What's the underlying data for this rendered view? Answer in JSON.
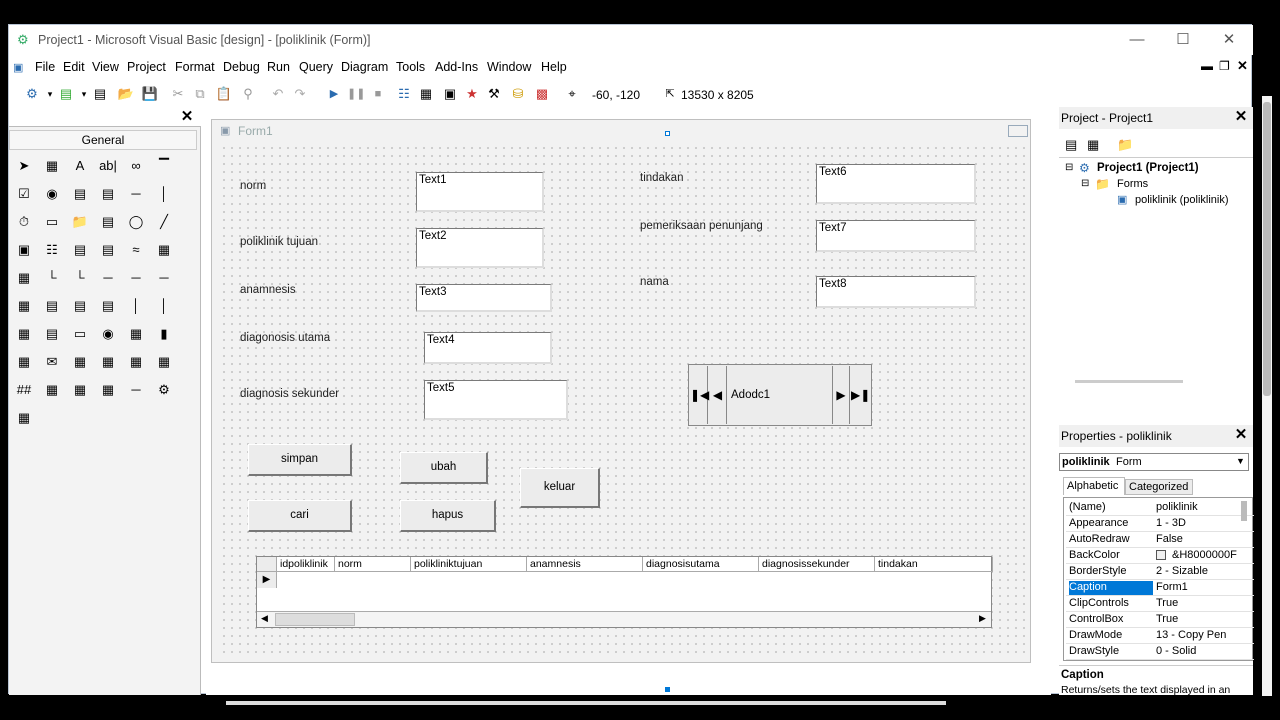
{
  "window": {
    "title": "Project1 - Microsoft Visual Basic [design] - [poliklinik (Form)]"
  },
  "menu": [
    "File",
    "Edit",
    "View",
    "Project",
    "Format",
    "Debug",
    "Run",
    "Query",
    "Diagram",
    "Tools",
    "Add-Ins",
    "Window",
    "Help"
  ],
  "toolbar": {
    "position": "-60, -120",
    "size": "13530 x 8205"
  },
  "toolbox": {
    "title": "General"
  },
  "form": {
    "caption": "Form1",
    "labels": {
      "norm": "norm",
      "poliklinik_tujuan": "poliklinik tujuan",
      "anamnesis": "anamnesis",
      "diagnosis_utama": "diagonosis utama",
      "diagnosis_sekunder": "diagnosis sekunder",
      "tindakan": "tindakan",
      "pemeriksaan": "pemeriksaan penunjang",
      "nama": "nama"
    },
    "textboxes": {
      "text1": "Text1",
      "text2": "Text2",
      "text3": "Text3",
      "text4": "Text4",
      "text5": "Text5",
      "text6": "Text6",
      "text7": "Text7",
      "text8": "Text8"
    },
    "buttons": {
      "simpan": "simpan",
      "ubah": "ubah",
      "keluar": "keluar",
      "cari": "cari",
      "hapus": "hapus"
    },
    "adodc": "Adodc1",
    "datagrid_columns": [
      "idpoliklinik",
      "norm",
      "polikliniktujuan",
      "anamnesis",
      "diagnosisutama",
      "diagnosissekunder",
      "tindakan"
    ]
  },
  "project": {
    "title": "Project - Project1",
    "root": "Project1 (Project1)",
    "folder": "Forms",
    "item": "poliklinik (poliklinik)"
  },
  "properties": {
    "title": "Properties - poliklinik",
    "object_name": "poliklinik",
    "object_type": "Form",
    "tabs": [
      "Alphabetic",
      "Categorized"
    ],
    "rows": [
      {
        "name": "(Name)",
        "value": "poliklinik"
      },
      {
        "name": "Appearance",
        "value": "1 - 3D"
      },
      {
        "name": "AutoRedraw",
        "value": "False"
      },
      {
        "name": "BackColor",
        "value": "&H8000000F"
      },
      {
        "name": "BorderStyle",
        "value": "2 - Sizable"
      },
      {
        "name": "Caption",
        "value": "Form1"
      },
      {
        "name": "ClipControls",
        "value": "True"
      },
      {
        "name": "ControlBox",
        "value": "True"
      },
      {
        "name": "DrawMode",
        "value": "13 - Copy Pen"
      },
      {
        "name": "DrawStyle",
        "value": "0 - Solid"
      }
    ],
    "selected": "Caption",
    "desc_title": "Caption",
    "desc_text": "Returns/sets the text displayed in an object's title bar or below an object's"
  },
  "colors": {
    "selection": "#0078d7",
    "accent_icon": "#2b6cb0"
  }
}
